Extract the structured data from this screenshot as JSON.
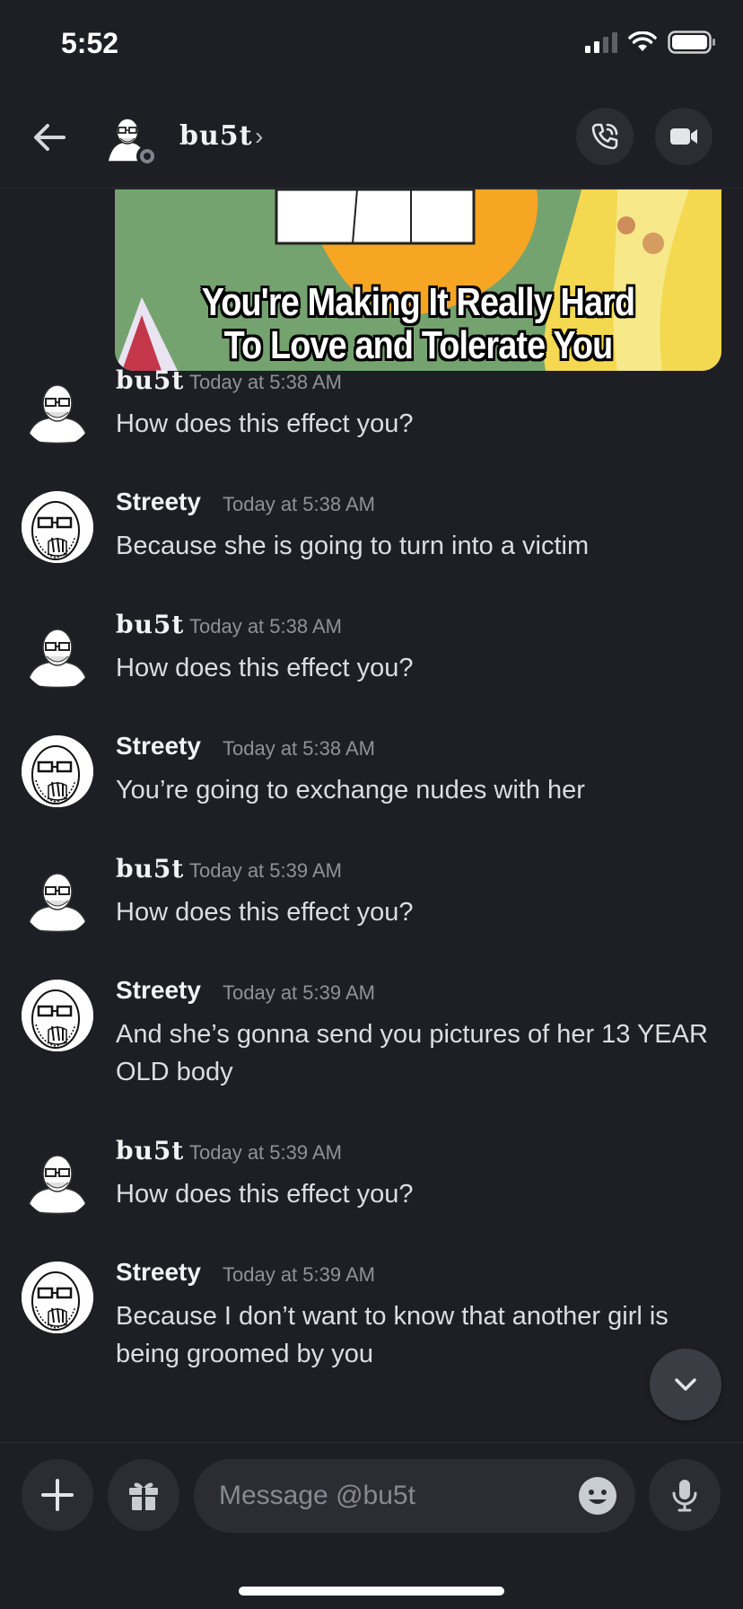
{
  "status_bar": {
    "time": "5:52"
  },
  "header": {
    "username": "bu5t",
    "chevron": "›"
  },
  "attachment": {
    "caption_line1": "You're Making It Really Hard",
    "caption_line2": "To Love and Tolerate You"
  },
  "messages": [
    {
      "author": "bu5t",
      "timestamp": "Today at 5:38 AM",
      "text": "How does this effect you?"
    },
    {
      "author": "Streety",
      "timestamp": "Today at 5:38 AM",
      "text": "Because she is going to turn into a victim"
    },
    {
      "author": "bu5t",
      "timestamp": "Today at 5:38 AM",
      "text": "How does this effect you?"
    },
    {
      "author": "Streety",
      "timestamp": "Today at 5:38 AM",
      "text": "You’re going to exchange nudes with her"
    },
    {
      "author": "bu5t",
      "timestamp": "Today at 5:39 AM",
      "text": "How does this effect you?"
    },
    {
      "author": "Streety",
      "timestamp": "Today at 5:39 AM",
      "text": "And she’s gonna send you pictures of her 13 YEAR OLD body"
    },
    {
      "author": "bu5t",
      "timestamp": "Today at 5:39 AM",
      "text": "How does this effect you?"
    },
    {
      "author": "Streety",
      "timestamp": "Today at 5:39 AM",
      "text": "Because I don’t want to know that another girl is being groomed by you"
    }
  ],
  "composer": {
    "placeholder": "Message @bu5t"
  },
  "icons": {
    "back": "back-arrow-icon",
    "call": "phone-icon",
    "video": "video-camera-icon",
    "scroll": "chevron-down-icon",
    "plus": "plus-icon",
    "gift": "gift-icon",
    "emoji": "emoji-icon",
    "mic": "microphone-icon"
  },
  "colors": {
    "background": "#1e1f24",
    "button": "#2b2d33",
    "text": "#dcdde1",
    "muted": "#8e9297"
  }
}
